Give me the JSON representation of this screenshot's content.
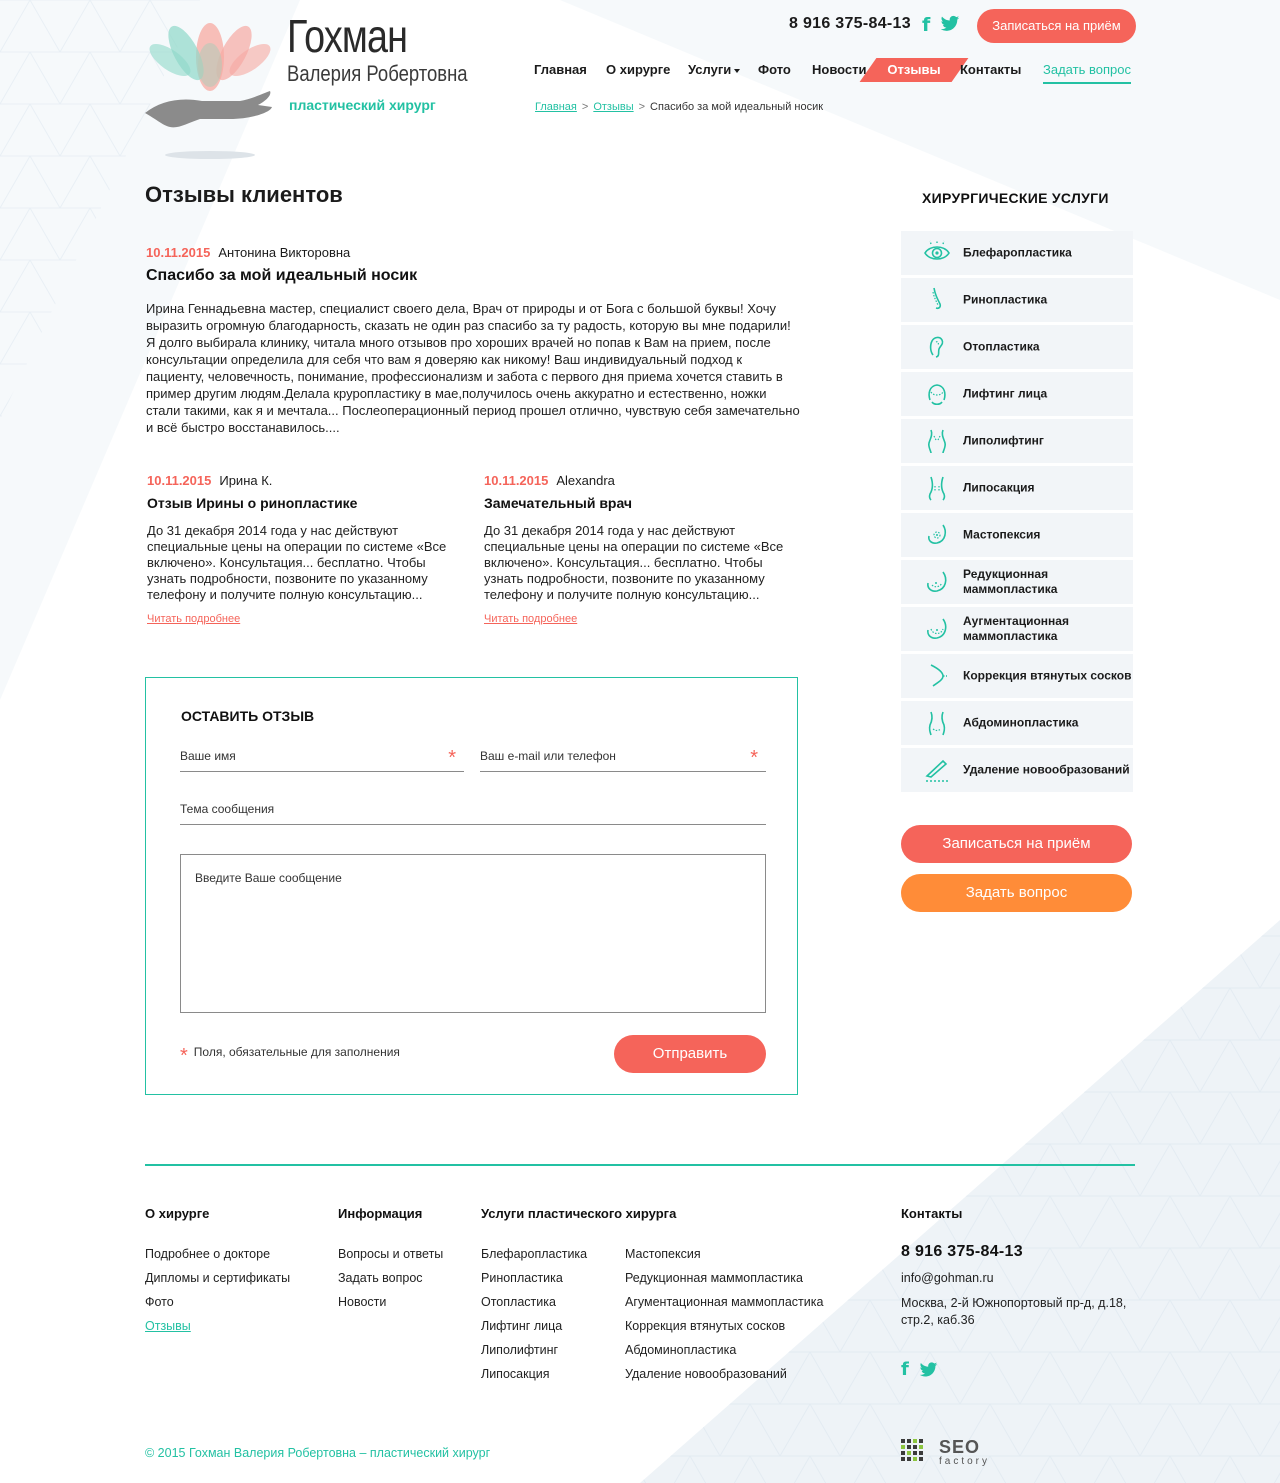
{
  "header": {
    "brand_name": "Гохман",
    "brand_sub": "Валерия Робертовна",
    "brand_role": "пластический хирург",
    "phone": "8 916 375-84-13",
    "facebook_label": "f",
    "appoint_button": "Записаться на приём",
    "nav": {
      "home": "Главная",
      "about": "О хирурге",
      "services": "Услуги",
      "photo": "Фото",
      "news": "Новости",
      "reviews": "Отзывы",
      "contacts": "Контакты",
      "ask": "Задать вопрос"
    },
    "breadcrumb": {
      "home": "Главная",
      "reviews": "Отзывы",
      "current": "Спасибо за мой идеальный носик",
      "separator": ">"
    }
  },
  "main": {
    "page_title": "Отзывы клиентов",
    "featured_review": {
      "date": "10.11.2015",
      "author": "Антонина Викторовна",
      "title": "Спасибо за мой идеальный носик",
      "text": "Ирина Геннадьевна мастер, специалист своего дела, Врач от природы и от Бога с большой буквы! Хочу выразить огромную благодарность, сказать не один раз спасибо за ту радость, которую вы мне подарили! Я долго выбирала клинику, читала много отзывов про хороших врачей но попав к Вам на прием, после консультации определила для себя что вам я доверяю как никому! Ваш индивидуальный подход к пациенту, человечность, понимание, профессионализм и забота с первого дня приема хочется ставить в пример другим людям.Делала круропластику в мае,получилось очень аккуратно и естественно, ножки стали такими, как я и мечтала... Послеоперационный период прошел отлично, чувствую себя замечательно и всё быстро восстанавилось...."
    },
    "reviews": [
      {
        "date": "10.11.2015",
        "author": "Ирина К.",
        "title": "Отзыв Ирины о ринопластике",
        "text": "До 31 декабря 2014 года у нас действуют специальные цены на операции по системе «Все включено». Консультация... бесплатно. Чтобы узнать подробности, позвоните по указанному телефону и получите полную консультацию...",
        "read_more": "Читать подробнее"
      },
      {
        "date": "10.11.2015",
        "author": "Alexandra",
        "title": "Замечательный врач",
        "text": "До 31 декабря 2014 года у нас действуют специальные цены на операции по системе «Все включено». Консультация... бесплатно. Чтобы узнать подробности, позвоните по указанному телефону и получите полную консультацию...",
        "read_more": "Читать подробнее"
      }
    ],
    "form": {
      "title": "ОСТАВИТЬ ОТЗЫВ",
      "name_label": "Ваше имя",
      "contact_label": "Ваш e-mail или телефон",
      "subject_label": "Тема сообщения",
      "message_placeholder": "Введите Ваше сообщение",
      "required_mark": "*",
      "required_note": "Поля, обязательные для заполнения",
      "submit": "Отправить"
    }
  },
  "sidebar": {
    "title": "ХИРУРГИЧЕСКИЕ УСЛУГИ",
    "items": [
      {
        "label": "Блефаропластика",
        "icon": "eye-icon"
      },
      {
        "label": "Ринопластика",
        "icon": "nose-icon"
      },
      {
        "label": "Отопластика",
        "icon": "ear-icon"
      },
      {
        "label": "Лифтинг лица",
        "icon": "face-icon"
      },
      {
        "label": "Липолифтинг",
        "icon": "body-icon"
      },
      {
        "label": "Липосакция",
        "icon": "waist-icon"
      },
      {
        "label": "Мастопексия",
        "icon": "breast-icon"
      },
      {
        "label": "Редукционная маммопластика",
        "icon": "breast-reduction-icon"
      },
      {
        "label": "Аугментационная маммопластика",
        "icon": "breast-augmentation-icon"
      },
      {
        "label": "Коррекция втянутых сосков",
        "icon": "nipple-icon"
      },
      {
        "label": "Абдоминопластика",
        "icon": "abdomen-icon"
      },
      {
        "label": "Удаление новообразований",
        "icon": "scalpel-icon"
      }
    ],
    "appoint_button": "Записаться на приём",
    "ask_button": "Задать вопрос"
  },
  "footer": {
    "about": {
      "title": "О хирурге",
      "links": [
        "Подробнее о докторе",
        "Дипломы и сертификаты",
        "Фото",
        "Отзывы"
      ]
    },
    "info": {
      "title": "Информация",
      "links": [
        "Вопросы и ответы",
        "Задать вопрос",
        "Новости"
      ]
    },
    "services": {
      "title": "Услуги пластического хирурга",
      "col1": [
        "Блефаропластика",
        "Ринопластика",
        "Отопластика",
        "Лифтинг лица",
        "Липолифтинг",
        "Липосакция"
      ],
      "col2": [
        "Мастопексия",
        "Редукционная маммопластика",
        "Агументационная маммопластика",
        "Коррекция втянутых сосков",
        "Абдоминопластика",
        "Удаление новообразований"
      ]
    },
    "contacts": {
      "title": "Контакты",
      "phone": "8 916 375-84-13",
      "email": "info@gohman.ru",
      "address": "Москва, 2-й Южнопортовый пр-д, д.18, стр.2, каб.36",
      "facebook_label": "f"
    },
    "copyright": "© 2015 Гохман Валерия Робертовна – пластический хирург",
    "dev_logo": {
      "name": "SEO",
      "sub": "factory"
    }
  },
  "colors": {
    "accent": "#23c1a3",
    "coral": "#f5645a",
    "orange": "#ff8c38"
  }
}
